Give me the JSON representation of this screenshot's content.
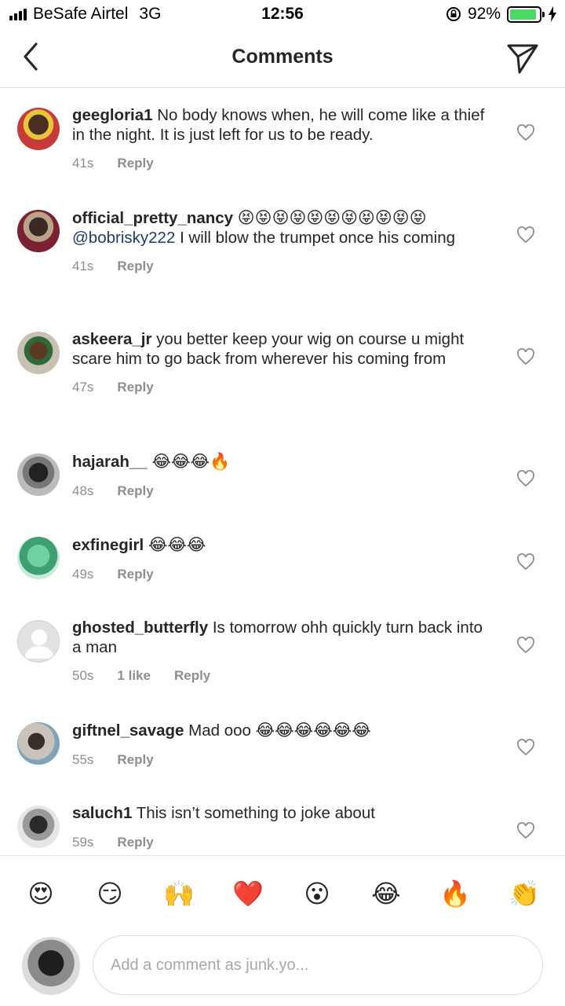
{
  "status_bar": {
    "carrier": "BeSafe Airtel",
    "network": "3G",
    "time": "12:56",
    "battery_percent": "92%",
    "battery_level": 0.92,
    "battery_color": "#4cd964"
  },
  "header": {
    "title": "Comments",
    "back_icon": "chevron-left-icon",
    "send_icon": "paper-plane-icon"
  },
  "comments": [
    {
      "username": "geegloria1",
      "text": "No body knows when, he will come like a thief in the night. It is just left for us to be ready.",
      "time": "41s",
      "likes": "",
      "reply_label": "Reply"
    },
    {
      "username": "official_pretty_nancy",
      "emojis": "😝😝😝😝😝😝😝😝😝😝😝",
      "mention": "@bobrisky222",
      "text": "I will blow the trumpet once his coming",
      "time": "41s",
      "likes": "",
      "reply_label": "Reply"
    },
    {
      "username": "askeera_jr",
      "text": "you better keep your wig on course u might scare him to go back from wherever his coming from",
      "time": "47s",
      "likes": "",
      "reply_label": "Reply"
    },
    {
      "username": "hajarah__",
      "emojis": "😂😂😂🔥",
      "text": "",
      "time": "48s",
      "likes": "",
      "reply_label": "Reply"
    },
    {
      "username": "exfinegirl",
      "emojis": "😂😂😂",
      "text": "",
      "time": "49s",
      "likes": "",
      "reply_label": "Reply"
    },
    {
      "username": "ghosted_butterfly",
      "text": "Is tomorrow ohh quickly turn back into a man",
      "time": "50s",
      "likes": "1 like",
      "reply_label": "Reply"
    },
    {
      "username": "giftnel_savage",
      "text": "Mad ooo",
      "emojis": "😂😂😂😂😂😂",
      "time": "55s",
      "likes": "",
      "reply_label": "Reply"
    },
    {
      "username": "saluch1",
      "text": "This isn’t something to joke about",
      "time": "59s",
      "likes": "",
      "reply_label": "Reply"
    }
  ],
  "emoji_bar": [
    "😍",
    "😏",
    "🙌",
    "❤️",
    "😮",
    "😂",
    "🔥",
    "👏"
  ],
  "comment_input": {
    "placeholder": "Add a comment as junk.yo..."
  }
}
